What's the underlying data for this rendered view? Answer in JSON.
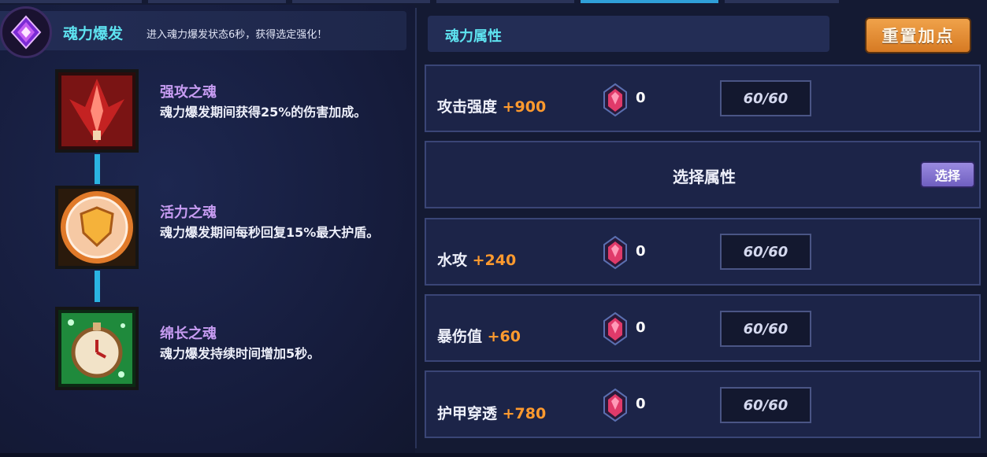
{
  "top_tabs": [
    {
      "active": false
    },
    {
      "active": false
    },
    {
      "active": false
    },
    {
      "active": false
    },
    {
      "active": true
    },
    {
      "active": false
    }
  ],
  "burst": {
    "icon": "purple-crystal-emblem-icon",
    "title": "魂力爆发",
    "description": "进入魂力爆发状态6秒，获得选定强化！"
  },
  "skills": [
    {
      "name": "强攻之魂",
      "description": "魂力爆发期间获得25%的伤害加成。",
      "icon": "red-sword-soul-icon"
    },
    {
      "name": "活力之魂",
      "description": "魂力爆发期间每秒回复15%最大护盾。",
      "icon": "orange-shield-soul-icon"
    },
    {
      "name": "绵长之魂",
      "description": "魂力爆发持续时间增加5秒。",
      "icon": "green-stopwatch-soul-icon"
    }
  ],
  "attributes": {
    "title": "魂力属性",
    "reset_label": "重置加点",
    "rows": [
      {
        "label": "攻击强度",
        "bonus": "+900",
        "gem_count": "0",
        "cap": "60/60"
      },
      {
        "select_label": "选择属性",
        "select_button": "选择"
      },
      {
        "label": "水攻",
        "bonus": "+240",
        "gem_count": "0",
        "cap": "60/60"
      },
      {
        "label": "暴伤值",
        "bonus": "+60",
        "gem_count": "0",
        "cap": "60/60"
      },
      {
        "label": "护甲穿透",
        "bonus": "+780",
        "gem_count": "0",
        "cap": "60/60"
      }
    ]
  },
  "colors": {
    "accent_cyan": "#5ee3f0",
    "skill_name_purple": "#c79cf2",
    "bonus_orange": "#ff9a2e",
    "reset_button": "#e28d35",
    "select_button": "#8676d4"
  }
}
